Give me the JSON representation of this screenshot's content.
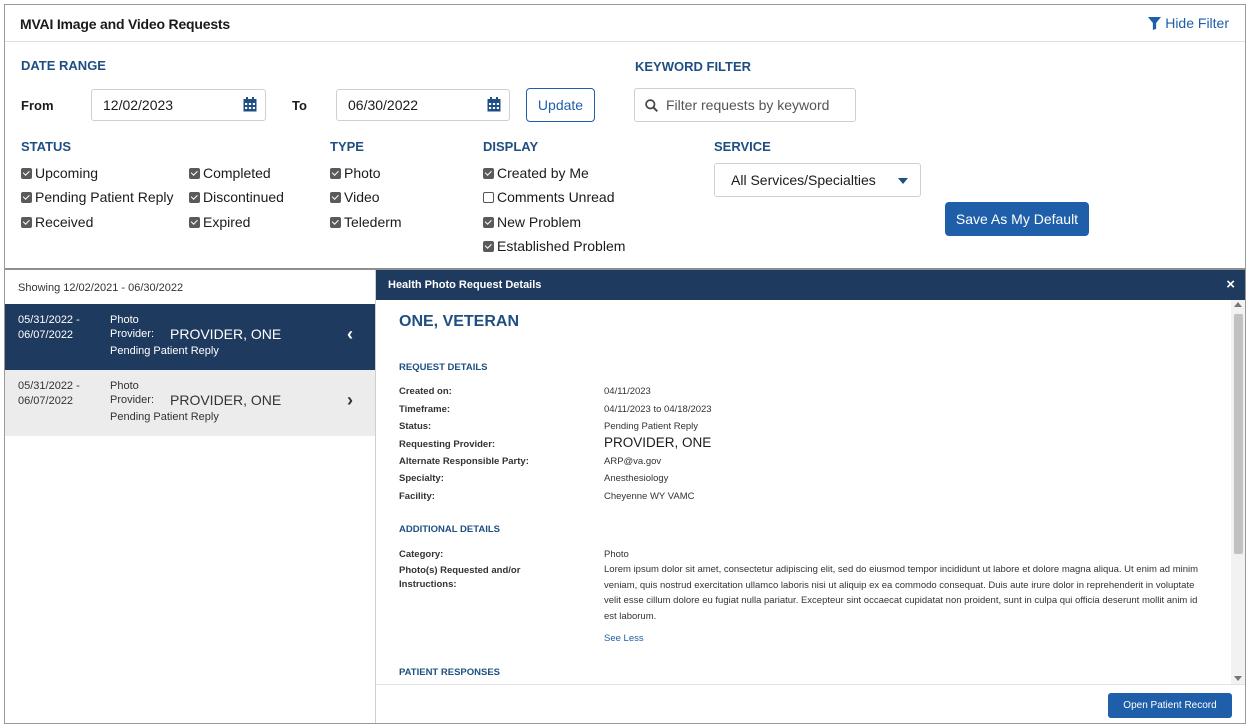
{
  "header": {
    "title": "MVAI Image and Video Requests",
    "hide_filter": "Hide Filter"
  },
  "filters": {
    "date_range_label": "DATE RANGE",
    "from_label": "From",
    "from_value": "12/02/2023",
    "to_label": "To",
    "to_value": "06/30/2022",
    "update_label": "Update",
    "keyword_label": "KEYWORD FILTER",
    "keyword_placeholder": "Filter requests by keyword",
    "status_label": "STATUS",
    "status": [
      {
        "label": "Upcoming",
        "checked": true
      },
      {
        "label": "Pending Patient Reply",
        "checked": true
      },
      {
        "label": "Received",
        "checked": true
      },
      {
        "label": "Completed",
        "checked": true
      },
      {
        "label": "Discontinued",
        "checked": true
      },
      {
        "label": "Expired",
        "checked": true
      }
    ],
    "type_label": "TYPE",
    "type": [
      {
        "label": "Photo",
        "checked": true
      },
      {
        "label": "Video",
        "checked": true
      },
      {
        "label": "Telederm",
        "checked": true
      }
    ],
    "display_label": "DISPLAY",
    "display": [
      {
        "label": "Created by Me",
        "checked": true
      },
      {
        "label": "Comments Unread",
        "checked": false
      },
      {
        "label": "New Problem",
        "checked": true
      },
      {
        "label": "Established Problem",
        "checked": true
      }
    ],
    "service_label": "SERVICE",
    "service_value": "All Services/Specialties",
    "save_default": "Save As My Default"
  },
  "list": {
    "showing": "Showing 12/02/2021 - 06/30/2022",
    "items": [
      {
        "date_start": "05/31/2022 -",
        "date_end": "06/07/2022",
        "type": "Photo",
        "provider_label": "Provider:",
        "provider": "PROVIDER, ONE",
        "status": "Pending Patient Reply",
        "chevron": "‹"
      },
      {
        "date_start": "05/31/2022 -",
        "date_end": "06/07/2022",
        "type": "Photo",
        "provider_label": "Provider:",
        "provider": "PROVIDER, ONE",
        "status": "Pending Patient Reply",
        "chevron": "›"
      }
    ]
  },
  "details": {
    "panel_title": "Health Photo Request Details",
    "close": "×",
    "patient_name": "ONE, VETERAN",
    "request_details_label": "REQUEST DETAILS",
    "rows": [
      {
        "label": "Created on:",
        "value": "04/11/2023"
      },
      {
        "label": "Timeframe:",
        "value": "04/11/2023 to 04/18/2023"
      },
      {
        "label": "Status:",
        "value": "Pending Patient Reply"
      },
      {
        "label": "Requesting Provider:",
        "value": "PROVIDER, ONE"
      },
      {
        "label": "Alternate Responsible Party:",
        "value": "ARP@va.gov"
      },
      {
        "label": "Specialty:",
        "value": "Anesthesiology"
      },
      {
        "label": "Facility:",
        "value": "Cheyenne WY VAMC"
      }
    ],
    "additional_details_label": "ADDITIONAL DETAILS",
    "category_label": "Category:",
    "category_value": "Photo",
    "instructions_label_1": "Photo(s) Requested and/or",
    "instructions_label_2": "Instructions:",
    "instructions_text": "Lorem ipsum dolor sit amet, consectetur adipiscing elit, sed do eiusmod tempor incididunt ut labore et dolore magna aliqua. Ut enim ad minim veniam, quis nostrud exercitation ullamco laboris nisi ut aliquip ex ea commodo consequat. Duis aute irure dolor in reprehenderit in voluptate velit esse cillum dolore eu fugiat nulla pariatur. Excepteur sint occaecat cupidatat non proident, sunt in culpa qui officia deserunt mollit anim id est laborum.",
    "see_less": "See Less",
    "patient_responses_label": "PATIENT RESPONSES",
    "open_record": "Open Patient Record"
  },
  "colors": {
    "navy": "#1f3a5f",
    "accent": "#1f5ea8",
    "label_blue": "#1f4f82"
  }
}
